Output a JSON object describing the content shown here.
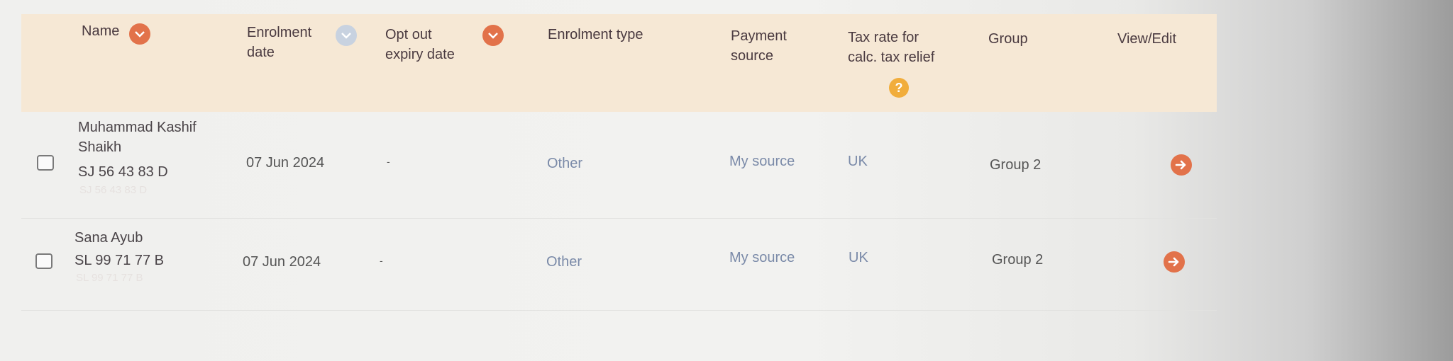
{
  "header": {
    "name": "Name",
    "enrolment_date": [
      "Enrolment",
      "date"
    ],
    "opt_out": [
      "Opt out",
      "expiry date"
    ],
    "enrolment_type": "Enrolment type",
    "payment_source": [
      "Payment",
      "source"
    ],
    "tax_rate": [
      "Tax rate for",
      "calc. tax relief"
    ],
    "help": "?",
    "group": "Group",
    "view_edit": "View/Edit"
  },
  "rows": [
    {
      "name_line1": "Muhammad Kashif",
      "name_line2": "Shaikh",
      "ni": "SJ 56 43 83 D",
      "ni_ghost": "SJ 56 43 83 D",
      "enrolment_date": "07 Jun 2024",
      "opt_out": "-",
      "enrolment_type": "Other",
      "payment_source": "My source",
      "tax_rate": "UK",
      "group": "Group 2"
    },
    {
      "name_line1": "Sana Ayub",
      "ni": "SL 99 71 77 B",
      "ni_ghost": "SL 99 71 77 B",
      "enrolment_date": "07 Jun 2024",
      "opt_out": "-",
      "enrolment_type": "Other",
      "payment_source": "My source",
      "tax_rate": "UK",
      "group": "Group 2"
    }
  ],
  "colors": {
    "header_bg": "#f6e8d5",
    "accent": "#e2724a",
    "muted_text": "#7a8aa8",
    "help_badge": "#f1ad3c"
  },
  "icons": {
    "sort_active": "chevron-down-icon",
    "sort_inactive": "chevron-down-icon",
    "help": "question-icon",
    "view_edit": "arrow-right-icon",
    "select": "checkbox-icon"
  }
}
